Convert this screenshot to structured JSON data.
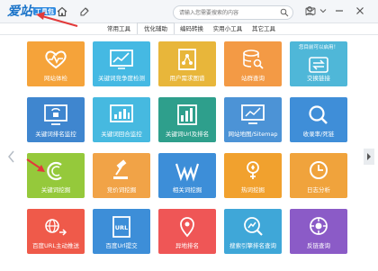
{
  "app": {
    "logo_text": "爱站",
    "logo_sub": "工具包"
  },
  "search": {
    "placeholder": "请输入您需要搜索的内容"
  },
  "tabs": [
    {
      "label": "常用工具",
      "active": false
    },
    {
      "label": "优化辅助",
      "active": true
    },
    {
      "label": "编码转换",
      "active": false
    },
    {
      "label": "实用小工具",
      "active": false
    },
    {
      "label": "其它工具",
      "active": false
    }
  ],
  "tiles": [
    {
      "label": "网站体检",
      "color": "#f5a33a",
      "icon": "heart-monitor-icon"
    },
    {
      "label": "关键词竞争度检测",
      "color": "#45b9e3",
      "icon": "trend-chart-icon"
    },
    {
      "label": "用户需求图谱",
      "color": "#e8b63a",
      "icon": "graph-nodes-icon"
    },
    {
      "label": "站群查询",
      "color": "#f39a45",
      "icon": "database-search-icon"
    },
    {
      "label": "交换链接",
      "color": "#4fb7d8",
      "icon": "exchange-link-icon",
      "badge": "您目前可以启用！"
    },
    {
      "label": "关键词排名监控",
      "color": "#3f86cf",
      "icon": "monitor-bars-icon"
    },
    {
      "label": "关键词回合监控",
      "color": "#46b9e0",
      "icon": "ranking-chart-icon"
    },
    {
      "label": "关键词Url及排名",
      "color": "#2e9f8c",
      "icon": "bar-report-icon"
    },
    {
      "label": "网站地图/Sitemap",
      "color": "#4c93d6",
      "icon": "sitemap-icon"
    },
    {
      "label": "收录率/死链",
      "color": "#3f8ed8",
      "icon": "search-lens-icon"
    },
    {
      "label": "关键词挖掘",
      "color": "#95c93b",
      "icon": "pacman-mine-icon"
    },
    {
      "label": "竞价词挖掘",
      "color": "#f1a347",
      "icon": "gavel-icon"
    },
    {
      "label": "相关词挖掘",
      "color": "#3d8ed8",
      "icon": "related-words-icon"
    },
    {
      "label": "热词挖掘",
      "color": "#f1a12e",
      "icon": "hot-shovel-icon"
    },
    {
      "label": "日志分析",
      "color": "#f0a33c",
      "icon": "clock-log-icon"
    },
    {
      "label": "百度URL主动推送",
      "color": "#ef5a4a",
      "icon": "url-push-icon"
    },
    {
      "label": "百度Url提交",
      "color": "#3d8ed8",
      "icon": "url-submit-icon"
    },
    {
      "label": "异地排名",
      "color": "#ef5656",
      "icon": "location-rank-icon"
    },
    {
      "label": "搜索引擎排名查询",
      "color": "#3fa7d8",
      "icon": "search-rank-icon"
    },
    {
      "label": "反链查询",
      "color": "#8b5bc7",
      "icon": "backlink-icon"
    }
  ],
  "colors": {
    "accent": "#1a73c8",
    "annotation": "#e23a3a"
  }
}
